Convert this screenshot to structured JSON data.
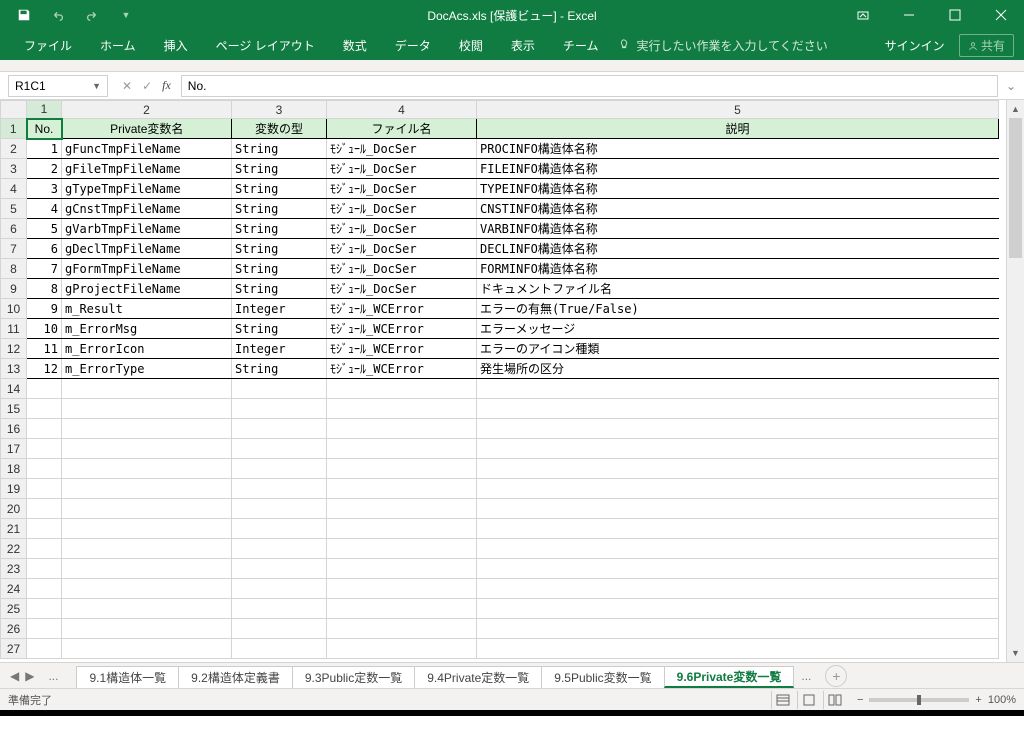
{
  "title": "DocAcs.xls  [保護ビュー] - Excel",
  "tabs": [
    "ファイル",
    "ホーム",
    "挿入",
    "ページ レイアウト",
    "数式",
    "データ",
    "校閲",
    "表示",
    "チーム"
  ],
  "tellme": "実行したい作業を入力してください",
  "signin": "サインイン",
  "share": "共有",
  "namebox": "R1C1",
  "fxvalue": "No.",
  "col_nums": [
    "1",
    "2",
    "3",
    "4",
    "5"
  ],
  "headers": [
    "No.",
    "Private変数名",
    "変数の型",
    "ファイル名",
    "説明"
  ],
  "rows": [
    {
      "no": "1",
      "name": "gFuncTmpFileName",
      "type": "String",
      "file": "ﾓｼﾞｭｰﾙ_DocSer",
      "desc": "PROCINFO構造体名称"
    },
    {
      "no": "2",
      "name": "gFileTmpFileName",
      "type": "String",
      "file": "ﾓｼﾞｭｰﾙ_DocSer",
      "desc": "FILEINFO構造体名称"
    },
    {
      "no": "3",
      "name": "gTypeTmpFileName",
      "type": "String",
      "file": "ﾓｼﾞｭｰﾙ_DocSer",
      "desc": "TYPEINFO構造体名称"
    },
    {
      "no": "4",
      "name": "gCnstTmpFileName",
      "type": "String",
      "file": "ﾓｼﾞｭｰﾙ_DocSer",
      "desc": "CNSTINFO構造体名称"
    },
    {
      "no": "5",
      "name": "gVarbTmpFileName",
      "type": "String",
      "file": "ﾓｼﾞｭｰﾙ_DocSer",
      "desc": "VARBINFO構造体名称"
    },
    {
      "no": "6",
      "name": "gDeclTmpFileName",
      "type": "String",
      "file": "ﾓｼﾞｭｰﾙ_DocSer",
      "desc": "DECLINFO構造体名称"
    },
    {
      "no": "7",
      "name": "gFormTmpFileName",
      "type": "String",
      "file": "ﾓｼﾞｭｰﾙ_DocSer",
      "desc": "FORMINFO構造体名称"
    },
    {
      "no": "8",
      "name": "gProjectFileName",
      "type": "String",
      "file": "ﾓｼﾞｭｰﾙ_DocSer",
      "desc": "ドキュメントファイル名"
    },
    {
      "no": "9",
      "name": "m_Result",
      "type": "Integer",
      "file": "ﾓｼﾞｭｰﾙ_WCError",
      "desc": "エラーの有無(True/False)"
    },
    {
      "no": "10",
      "name": "m_ErrorMsg",
      "type": "String",
      "file": "ﾓｼﾞｭｰﾙ_WCError",
      "desc": "エラーメッセージ"
    },
    {
      "no": "11",
      "name": "m_ErrorIcon",
      "type": "Integer",
      "file": "ﾓｼﾞｭｰﾙ_WCError",
      "desc": "エラーのアイコン種類"
    },
    {
      "no": "12",
      "name": "m_ErrorType",
      "type": "String",
      "file": "ﾓｼﾞｭｰﾙ_WCError",
      "desc": "発生場所の区分"
    }
  ],
  "empty_start": 14,
  "empty_end": 27,
  "sheets": [
    "9.1構造体一覧",
    "9.2構造体定義書",
    "9.3Public定数一覧",
    "9.4Private定数一覧",
    "9.5Public変数一覧",
    "9.6Private変数一覧"
  ],
  "active_sheet": 5,
  "status": "準備完了",
  "zoom": "100%"
}
